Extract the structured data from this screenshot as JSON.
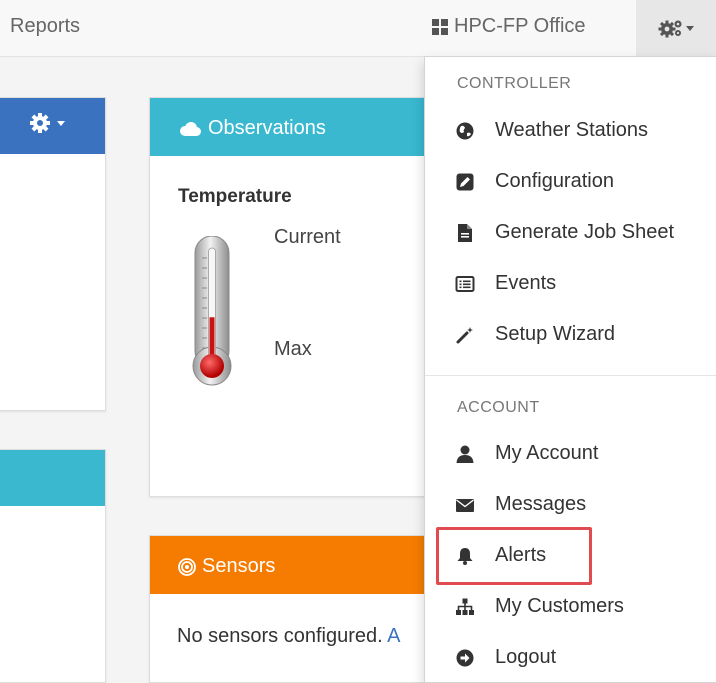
{
  "navbar": {
    "reports_label": "Reports",
    "office_label": "HPC-FP Office"
  },
  "observations": {
    "title": "Observations",
    "temperature_label": "Temperature",
    "current_label": "Current",
    "max_label": "Max",
    "thermometer_fill_fraction": 0.42
  },
  "sensors": {
    "title": "Sensors",
    "message": "No sensors configured. ",
    "link_fragment": "A"
  },
  "dropdown": {
    "controller_header": "CONTROLLER",
    "account_header": "ACCOUNT",
    "controller_items": [
      {
        "label": "Weather Stations",
        "icon": "globe-icon"
      },
      {
        "label": "Configuration",
        "icon": "edit-icon"
      },
      {
        "label": "Generate Job Sheet",
        "icon": "file-icon"
      },
      {
        "label": "Events",
        "icon": "list-alt-icon"
      },
      {
        "label": "Setup Wizard",
        "icon": "magic-wand-icon"
      }
    ],
    "account_items": [
      {
        "label": "My Account",
        "icon": "user-icon"
      },
      {
        "label": "Messages",
        "icon": "envelope-icon"
      },
      {
        "label": "Alerts",
        "icon": "bell-icon"
      },
      {
        "label": "My Customers",
        "icon": "sitemap-icon"
      },
      {
        "label": "Logout",
        "icon": "circle-arrow-right-icon"
      }
    ]
  },
  "colors": {
    "blue_header": "#3a72bf",
    "cyan_header": "#39b8d0",
    "orange_header": "#f57c00",
    "highlight_border": "#e04b4f"
  }
}
